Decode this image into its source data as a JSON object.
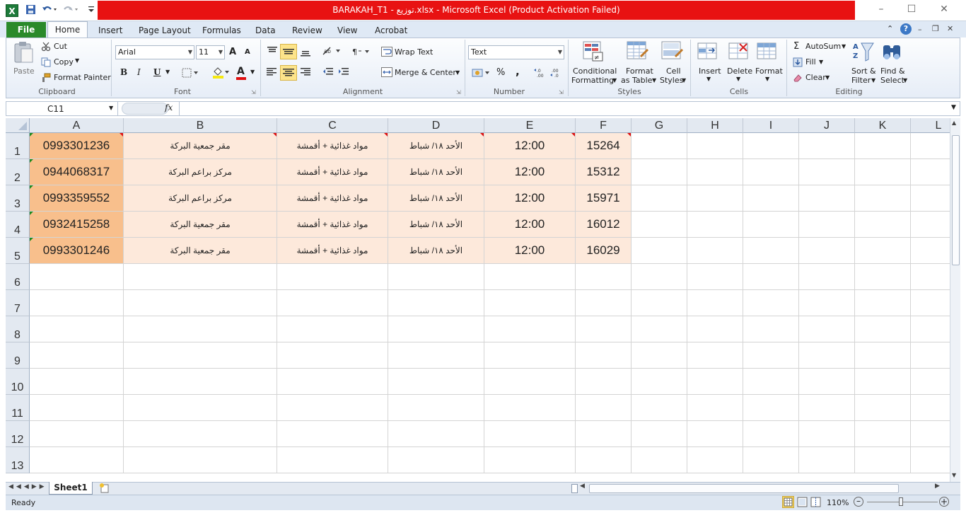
{
  "window": {
    "title": "BARAKAH_T1 - توزيع.xlsx - Microsoft Excel (Product Activation Failed)"
  },
  "ribbon_tabs": [
    "File",
    "Home",
    "Insert",
    "Page Layout",
    "Formulas",
    "Data",
    "Review",
    "View",
    "Acrobat"
  ],
  "clipboard": {
    "paste": "Paste",
    "cut": "Cut",
    "copy": "Copy",
    "format_painter": "Format Painter",
    "group": "Clipboard"
  },
  "font": {
    "name": "Arial",
    "size": "11",
    "group": "Font",
    "bold": "B",
    "italic": "I",
    "underline": "U",
    "grow": "A",
    "shrink": "A",
    "color_a": "A"
  },
  "alignment": {
    "wrap_text": "Wrap Text",
    "merge_center": "Merge & Center",
    "group": "Alignment"
  },
  "number": {
    "format": "Text",
    "percent": "%",
    "comma": ",",
    "group": "Number",
    "dec_inc": ".0\n.00",
    "dec_dec": ".00\n.0"
  },
  "styles": {
    "conditional": "Conditional",
    "conditional2": "Formatting",
    "format_table": "Format",
    "format_table2": "as Table",
    "cell_styles": "Cell",
    "cell_styles2": "Styles",
    "group": "Styles"
  },
  "cells": {
    "insert": "Insert",
    "delete": "Delete",
    "format": "Format",
    "group": "Cells"
  },
  "editing": {
    "autosum": "AutoSum",
    "fill": "Fill",
    "clear": "Clear",
    "sort": "Sort &",
    "sort2": "Filter",
    "find": "Find &",
    "find2": "Select",
    "group": "Editing"
  },
  "formula_bar": {
    "name_box": "C11",
    "fx": "fx",
    "value": ""
  },
  "columns": [
    "A",
    "B",
    "C",
    "D",
    "E",
    "F",
    "G",
    "H",
    "I",
    "J",
    "K",
    "L"
  ],
  "rows": [
    "1",
    "2",
    "3",
    "4",
    "5",
    "6",
    "7",
    "8",
    "9",
    "10",
    "11",
    "12",
    "13"
  ],
  "table": [
    [
      "0993301236",
      "مقر جمعية البركة",
      "مواد غذائية + أقمشة",
      "الأحد ١٨/ شباط",
      "12:00",
      "15264"
    ],
    [
      "0944068317",
      "مركز براعم البركة",
      "مواد غذائية + أقمشة",
      "الأحد ١٨/ شباط",
      "12:00",
      "15312"
    ],
    [
      "0993359552",
      "مركز براعم البركة",
      "مواد غذائية + أقمشة",
      "الأحد ١٨/ شباط",
      "12:00",
      "15971"
    ],
    [
      "0932415258",
      "مقر جمعية البركة",
      "مواد غذائية + أقمشة",
      "الأحد ١٨/ شباط",
      "12:00",
      "16012"
    ],
    [
      "0993301246",
      "مقر جمعية البركة",
      "مواد غذائية + أقمشة",
      "الأحد ١٨/ شباط",
      "12:00",
      "16029"
    ]
  ],
  "sheet_tabs": [
    "Sheet1"
  ],
  "status": {
    "ready": "Ready",
    "zoom": "110%"
  },
  "colors": {
    "title_bar": "#e81212",
    "file_tab": "#2a8a2a",
    "col_a_fill": "#f8bf8c",
    "data_fill": "#fde9db"
  }
}
